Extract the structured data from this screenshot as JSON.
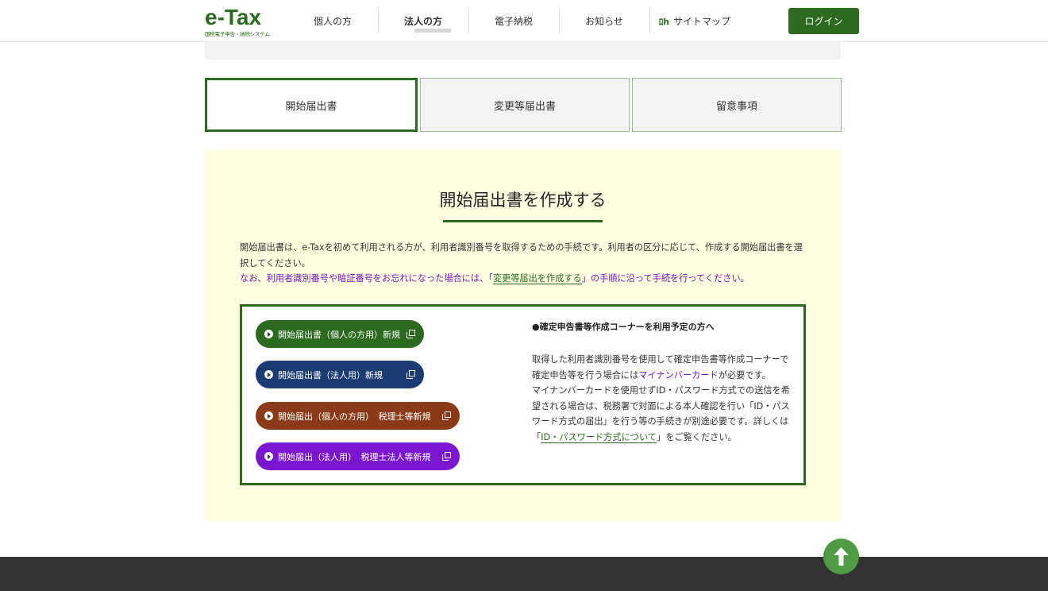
{
  "header": {
    "logo_main": "e-Tax",
    "logo_sub": "国税電子申告・納税システム",
    "nav": [
      "個人の方",
      "法人の方",
      "電子納税",
      "お知らせ",
      "サイトマップ"
    ],
    "sitemap_icon": "sitemap-icon",
    "login": "ログイン"
  },
  "tabs": [
    "開始届出書",
    "変更等届出書",
    "留意事項"
  ],
  "panel": {
    "title": "開始届出書を作成する",
    "intro": "開始届出書は、e-Taxを初めて利用される方が、利用者識別番号を取得するための手続です。利用者の区分に応じて、作成する開始届出書を選択してください。",
    "notice_before": "なお、利用者識別番号や暗証番号をお忘れになった場合には、「",
    "notice_link": "変更等届出を作成する",
    "notice_after": "」の手順に沿って手続を行ってください。",
    "buttons": [
      {
        "label": "開始届出書（個人の方用）新規",
        "color": "#2b6a1f"
      },
      {
        "label": "開始届出書（法人用）新規",
        "color": "#1b3c73"
      },
      {
        "label": "開始届出（個人の方用）　税理士等新規",
        "color": "#8a3a16"
      },
      {
        "label": "開始届出（法人用）　税理士法人等新規",
        "color": "#7a16d0"
      }
    ],
    "right_heading": "●確定申告書等作成コーナーを利用予定の方へ",
    "right_p1": "取得した利用者識別番号を使用して確定申告書等作成コーナーで確定申告等を行う場合には",
    "right_p1_link": "マイナンバーカード",
    "right_p1_end": "が必要です。",
    "right_p2": "マイナンバーカードを使用せずID・パスワード方式での送信を希望される場合は、税務署で対面による本人確認を行い「ID・パスワード方式の届出」を行う等の手続きが別途必要です。詳しくは「",
    "right_p2_link": "ID・パスワード方式について",
    "right_p2_end": "」をご覧ください。"
  },
  "page_top_icon": "arrow-up-icon"
}
